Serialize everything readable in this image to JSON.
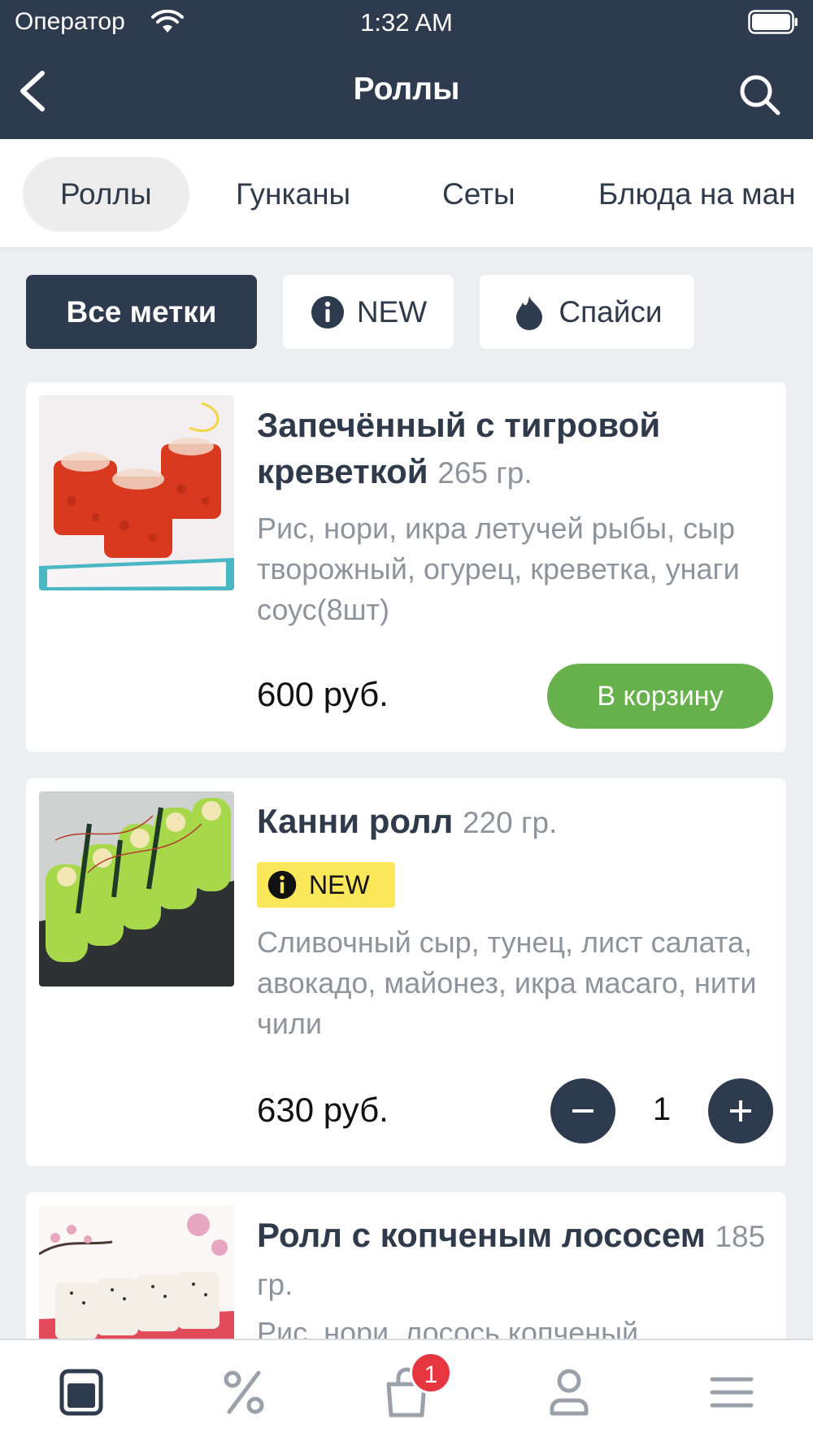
{
  "status_bar": {
    "carrier": "Оператор",
    "time": "1:32 AM"
  },
  "header": {
    "title": "Роллы"
  },
  "categories": [
    "Роллы",
    "Гунканы",
    "Сеты",
    "Блюда на ман"
  ],
  "filters": [
    {
      "label": "Все метки",
      "icon": ""
    },
    {
      "label": "NEW",
      "icon": "info-icon"
    },
    {
      "label": "Спайси",
      "icon": "flame-icon"
    }
  ],
  "products": [
    {
      "title": "Запечённый с тигровой креветкой",
      "weight": "265 гр.",
      "description": "Рис, нори, икра летучей рыбы, сыр творожный, огурец, креветка, унаги соус(8шт)",
      "price": "600 руб.",
      "action_label": "В корзину"
    },
    {
      "title": "Канни  ролл",
      "weight": "220 гр.",
      "badge": "NEW",
      "description": "Сливочный сыр, тунец, лист салата, авокадо, майонез, икра масаго, нити чили",
      "price": "630 руб.",
      "quantity": "1"
    },
    {
      "title": "Ролл с копченым лососем",
      "weight": "185 гр.",
      "description": "Рис, нори, лосось копченый"
    }
  ],
  "tabbar": {
    "items": [
      "menu-icon",
      "percent-icon",
      "cart-icon",
      "profile-icon",
      "hamburger-icon"
    ],
    "cart_count": "1"
  },
  "colors": {
    "header_bg": "#2e3a4d",
    "accent_green": "#67b14d",
    "badge_yellow": "#fbe75a",
    "badge_red": "#e6363f"
  }
}
